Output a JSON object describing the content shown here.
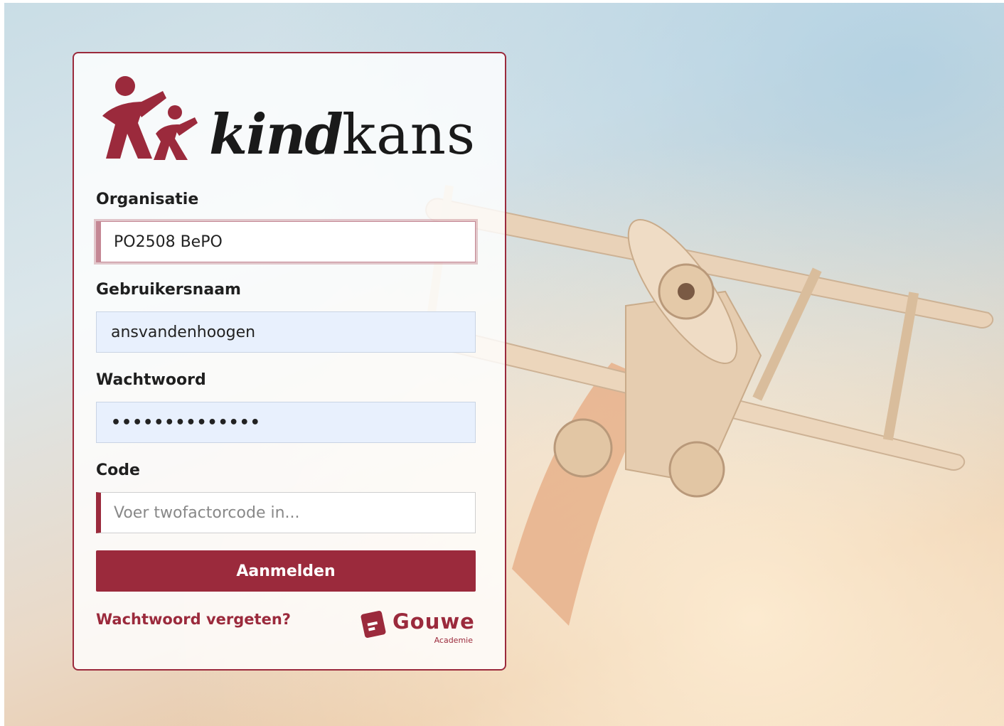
{
  "brand": {
    "logo_word_kind": "kind",
    "logo_word_kans": "kans",
    "accent_color": "#9b2a3c"
  },
  "form": {
    "organisatie": {
      "label": "Organisatie",
      "value": "PO2508 BePO"
    },
    "gebruikersnaam": {
      "label": "Gebruikersnaam",
      "value": "ansvandenhoogen"
    },
    "wachtwoord": {
      "label": "Wachtwoord",
      "value": "••••••••••••••"
    },
    "code": {
      "label": "Code",
      "placeholder": "Voer twofactorcode in..."
    },
    "submit_label": "Aanmelden",
    "forgot_label": "Wachtwoord vergeten?"
  },
  "partner": {
    "name": "Gouwe",
    "subtitle": "Academie"
  }
}
